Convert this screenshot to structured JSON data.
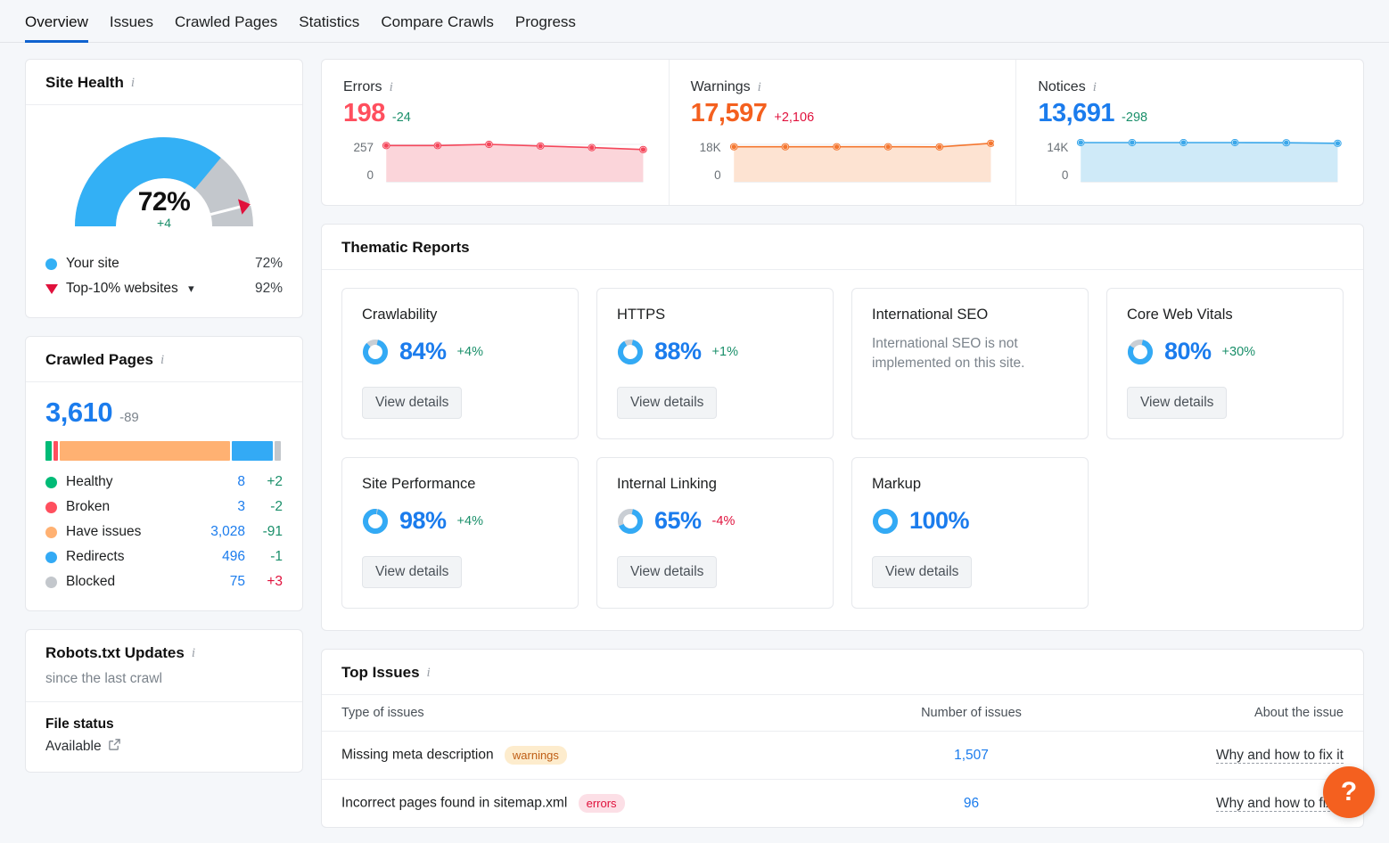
{
  "tabs": [
    {
      "label": "Overview",
      "active": true
    },
    {
      "label": "Issues",
      "active": false
    },
    {
      "label": "Crawled Pages",
      "active": false
    },
    {
      "label": "Statistics",
      "active": false
    },
    {
      "label": "Compare Crawls",
      "active": false
    },
    {
      "label": "Progress",
      "active": false
    }
  ],
  "site_health": {
    "title": "Site Health",
    "gauge_value": "72%",
    "gauge_delta": "+4",
    "legend": [
      {
        "label": "Your site",
        "value": "72%",
        "color": "#33b0f5",
        "marker": "dot"
      },
      {
        "label": "Top-10% websites",
        "value": "92%",
        "color": "#e0113c",
        "marker": "triangle"
      }
    ],
    "chart_data": {
      "type": "gauge",
      "title": "Site Health",
      "value": 72,
      "benchmark": 92,
      "min": 0,
      "max": 100,
      "value_color": "#33b0f5",
      "remainder_color": "#c3c7cc",
      "benchmark_color": "#e0113c"
    }
  },
  "crawled_pages": {
    "title": "Crawled Pages",
    "total": "3,610",
    "total_delta": "-89",
    "rows": [
      {
        "label": "Healthy",
        "value": "8",
        "delta": "+2",
        "delta_kind": "green",
        "color": "#00bb77"
      },
      {
        "label": "Broken",
        "value": "3",
        "delta": "-2",
        "delta_kind": "green",
        "color": "#ff4f5e"
      },
      {
        "label": "Have issues",
        "value": "3,028",
        "delta": "-91",
        "delta_kind": "green",
        "color": "#ffb172"
      },
      {
        "label": "Redirects",
        "value": "496",
        "delta": "-1",
        "delta_kind": "green",
        "color": "#33aaf5"
      },
      {
        "label": "Blocked",
        "value": "75",
        "delta": "+3",
        "delta_kind": "red",
        "color": "#c3c7cc"
      }
    ],
    "chart_data": {
      "type": "bar",
      "title": "Crawled Pages breakdown",
      "categories": [
        "Healthy",
        "Broken",
        "Have issues",
        "Redirects",
        "Blocked"
      ],
      "values": [
        8,
        3,
        3028,
        496,
        75
      ],
      "total": 3610,
      "colors": [
        "#00bb77",
        "#ff4f5e",
        "#ffb172",
        "#33aaf5",
        "#c3c7cc"
      ],
      "display_widths_pct": [
        2.5,
        2.2,
        71.5,
        17.5,
        2.5
      ]
    }
  },
  "robots": {
    "title": "Robots.txt Updates",
    "subtitle": "since the last crawl",
    "file_status_label": "File status",
    "file_status_value": "Available",
    "ext_icon": "external-link-icon"
  },
  "stats": [
    {
      "name": "Errors",
      "value": "198",
      "delta": "-24",
      "color": "#ff4f5e",
      "delta_color": "#1a8f6a",
      "axis_top": "257",
      "axis_bottom": "0",
      "chart_data": {
        "type": "area",
        "title": "Errors trend",
        "ylim": [
          0,
          257
        ],
        "x": [
          0,
          1,
          2,
          3,
          4,
          5
        ],
        "values": [
          232,
          232,
          242,
          228,
          215,
          198
        ],
        "line_color": "#f4465a",
        "fill_color": "#fbd5da"
      }
    },
    {
      "name": "Warnings",
      "value": "17,597",
      "delta": "+2,106",
      "color": "#f4601f",
      "delta_color": "#e0113c",
      "axis_top": "18K",
      "axis_bottom": "0",
      "chart_data": {
        "type": "area",
        "title": "Warnings trend",
        "ylim": [
          0,
          18000
        ],
        "x": [
          0,
          1,
          2,
          3,
          4,
          5
        ],
        "values": [
          15500,
          15500,
          15500,
          15500,
          15450,
          17597
        ],
        "line_color": "#f4762f",
        "fill_color": "#fde3d2"
      }
    },
    {
      "name": "Notices",
      "value": "13,691",
      "delta": "-298",
      "color": "#1b7ced",
      "delta_color": "#1a8f6a",
      "axis_top": "14K",
      "axis_bottom": "0",
      "chart_data": {
        "type": "area",
        "title": "Notices trend",
        "ylim": [
          0,
          14000
        ],
        "x": [
          0,
          1,
          2,
          3,
          4,
          5
        ],
        "values": [
          13989,
          13989,
          13989,
          13989,
          13900,
          13691
        ],
        "line_color": "#3aa7ea",
        "fill_color": "#cfeaf8"
      }
    }
  ],
  "thematic": {
    "title": "Thematic Reports",
    "view_details_label": "View details",
    "cards": [
      {
        "title": "Crawlability",
        "pct": "84%",
        "pct_num": 84,
        "delta": "+4%",
        "delta_kind": "green",
        "has_button": true
      },
      {
        "title": "HTTPS",
        "pct": "88%",
        "pct_num": 88,
        "delta": "+1%",
        "delta_kind": "green",
        "has_button": true
      },
      {
        "title": "International SEO",
        "note": "International SEO is not implemented on this site.",
        "has_button": false
      },
      {
        "title": "Core Web Vitals",
        "pct": "80%",
        "pct_num": 80,
        "delta": "+30%",
        "delta_kind": "green",
        "has_button": true
      },
      {
        "title": "Site Performance",
        "pct": "98%",
        "pct_num": 98,
        "delta": "+4%",
        "delta_kind": "green",
        "has_button": true
      },
      {
        "title": "Internal Linking",
        "pct": "65%",
        "pct_num": 65,
        "delta": "-4%",
        "delta_kind": "red",
        "has_button": true
      },
      {
        "title": "Markup",
        "pct": "100%",
        "pct_num": 100,
        "delta": "",
        "delta_kind": "none",
        "has_button": true
      }
    ],
    "chart_data": {
      "type": "bar",
      "title": "Thematic Reports scores",
      "categories": [
        "Crawlability",
        "HTTPS",
        "Core Web Vitals",
        "Site Performance",
        "Internal Linking",
        "Markup"
      ],
      "values": [
        84,
        88,
        80,
        98,
        65,
        100
      ],
      "deltas": [
        4,
        1,
        30,
        4,
        -4,
        null
      ],
      "ylabel": "Score %",
      "ylim": [
        0,
        100
      ]
    }
  },
  "top_issues": {
    "title": "Top Issues",
    "columns": [
      "Type of issues",
      "Number of issues",
      "About the issue"
    ],
    "rows": [
      {
        "type": "Missing meta description",
        "badge": "warnings",
        "badge_kind": "warnings",
        "count": "1,507",
        "link": "Why and how to fix it"
      },
      {
        "type": "Incorrect pages found in sitemap.xml",
        "badge": "errors",
        "badge_kind": "errors",
        "count": "96",
        "link": "Why and how to fix it"
      }
    ]
  },
  "help": {
    "label": "?"
  }
}
